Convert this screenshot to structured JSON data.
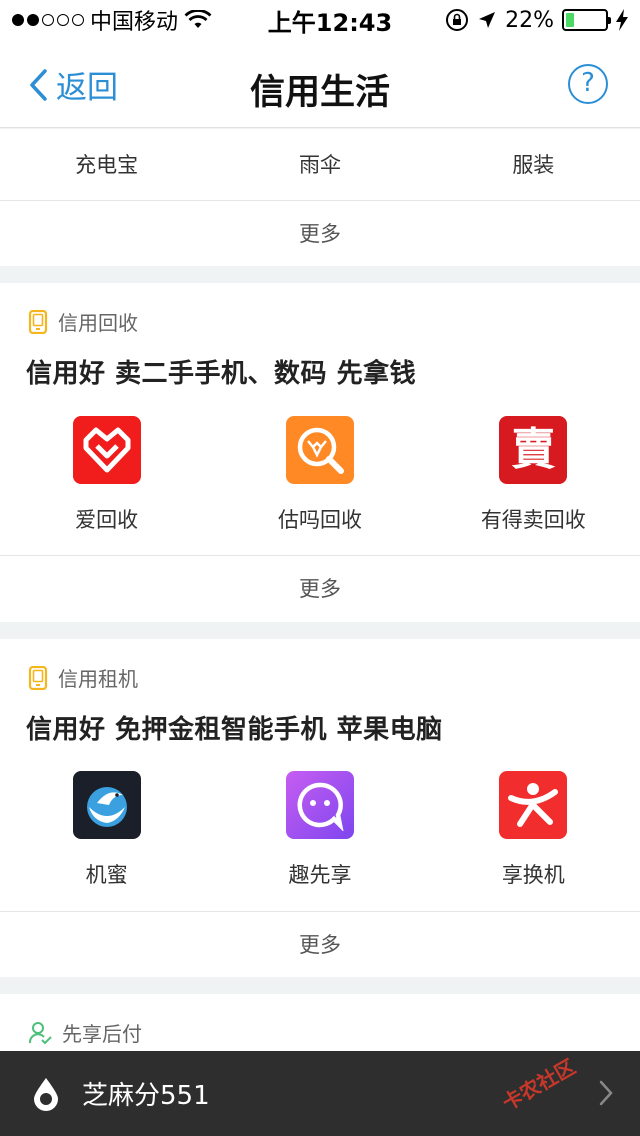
{
  "status_bar": {
    "carrier": "中国移动",
    "time": "上午12:43",
    "battery": "22%",
    "battery_level": 0.22,
    "signal_dots": 5,
    "signal_dots_on": 2
  },
  "nav": {
    "back_label": "返回",
    "title": "信用生活",
    "help_label": "?"
  },
  "top_section": {
    "items": [
      "充电宝",
      "雨伞",
      "服装"
    ],
    "more_label": "更多"
  },
  "recycle_section": {
    "category": "信用回收",
    "headline": "信用好 卖二手手机、数码 先拿钱",
    "apps": [
      {
        "label": "爱回收",
        "icon": "heart-shield-icon",
        "color": "#f11c1c"
      },
      {
        "label": "估吗回收",
        "icon": "magnifier-antler-icon",
        "color": "#ff8a25"
      },
      {
        "label": "有得卖回收",
        "icon": "mai-seal-icon",
        "color": "#d71920",
        "glyph": "賣"
      }
    ],
    "more_label": "更多"
  },
  "rent_section": {
    "category": "信用租机",
    "headline": "信用好 免押金租智能手机 苹果电脑",
    "apps": [
      {
        "label": "机蜜",
        "icon": "bird-globe-icon",
        "color": "#1b1f2a"
      },
      {
        "label": "趣先享",
        "icon": "chat-face-icon",
        "color": "#9b4cf0"
      },
      {
        "label": "享换机",
        "icon": "running-person-icon",
        "color": "#f22d2d"
      }
    ],
    "more_label": "更多"
  },
  "prepay_section": {
    "category": "先享后付"
  },
  "bottom_bar": {
    "label": "芝麻分551",
    "watermark": "卡农社区"
  },
  "colors": {
    "accent": "#2c8fd6",
    "category_icon": "#f5b51c",
    "prepay_icon": "#4cc07a",
    "background": "#eff3f3"
  }
}
